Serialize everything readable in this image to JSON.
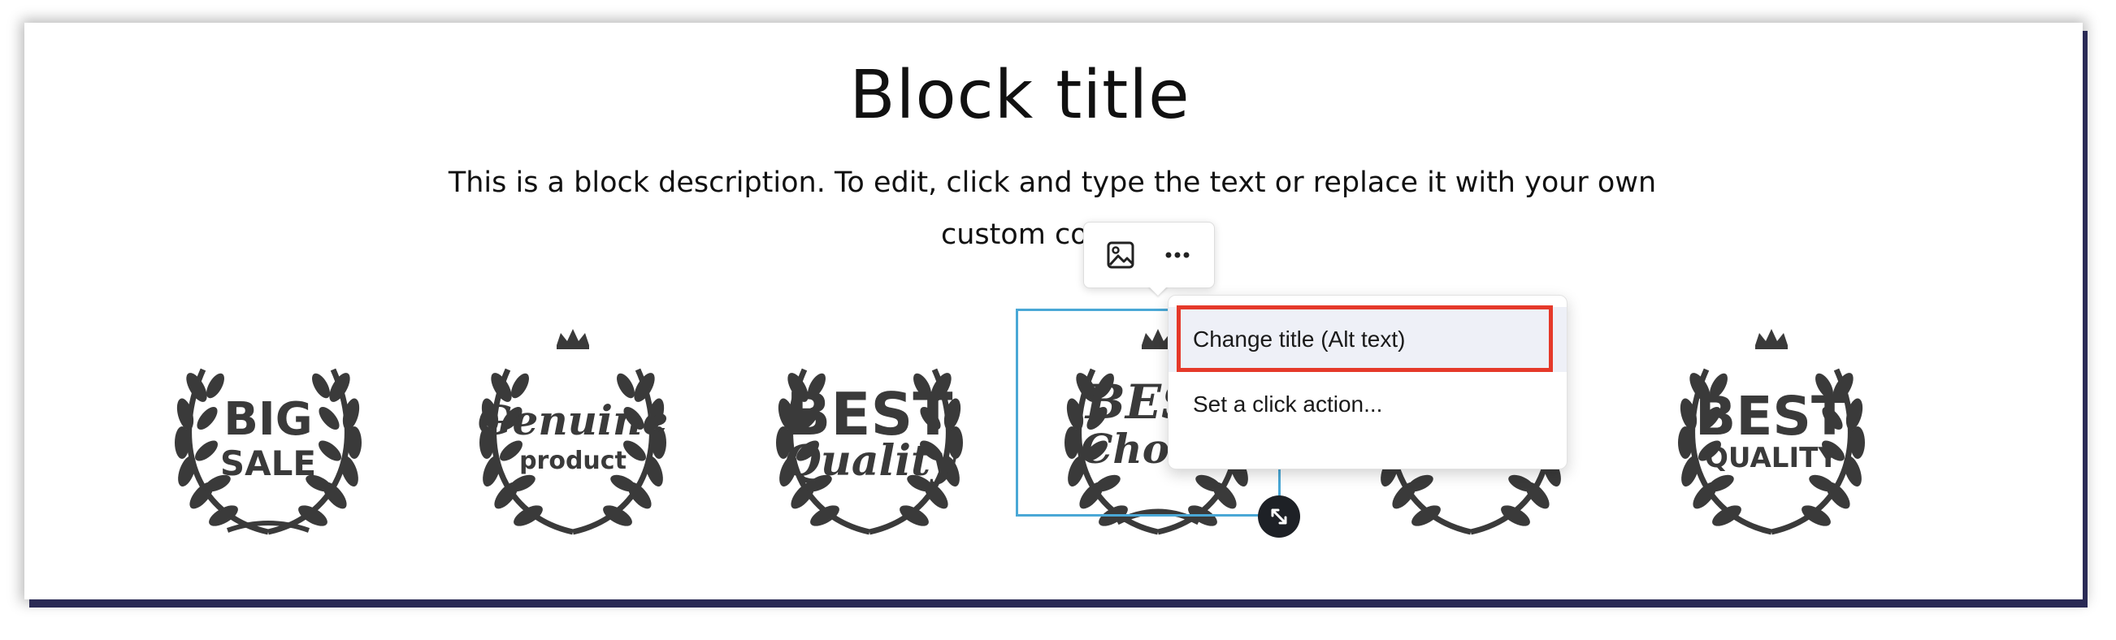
{
  "block": {
    "title": "Block title",
    "description": "This is a block description. To edit, click and type the text or replace it with your own custom content"
  },
  "badges": [
    {
      "line1": "BIG",
      "line2": "SALE"
    },
    {
      "line1": "Genuine",
      "line2": "product"
    },
    {
      "line1": "BEST",
      "line2": "Quality"
    },
    {
      "line1": "BEST",
      "line2": "Choice"
    },
    {
      "line1": "",
      "line2": ""
    },
    {
      "line1": "BEST",
      "line2": "QUALITY"
    }
  ],
  "toolbar": {
    "image_icon": "image-icon",
    "more_icon": "more-horizontal-icon"
  },
  "context_menu": {
    "items": [
      {
        "label": "Change title (Alt text)"
      },
      {
        "label": "Set a click action..."
      }
    ]
  },
  "colors": {
    "selection_border": "#4aa8d6",
    "highlight_border": "#e5392a",
    "badge_fill": "#3a3a3a"
  }
}
